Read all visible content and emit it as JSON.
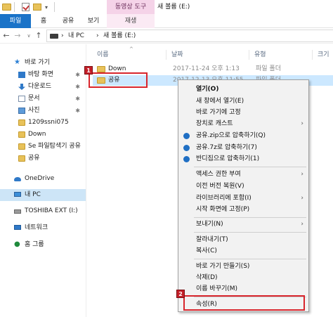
{
  "titlebar": {
    "context_tab": "동영상 도구",
    "window_title": "새 볼륨 (E:)"
  },
  "ribbon": {
    "tabs": [
      "파일",
      "홈",
      "공유",
      "보기",
      "재생"
    ]
  },
  "address": {
    "segments": [
      "›",
      "내 PC",
      "›",
      "새 볼륨 (E:)"
    ]
  },
  "sidebar": {
    "items": [
      {
        "label": "바로 가기",
        "pinned": false
      },
      {
        "label": "바탕 화면",
        "pinned": true
      },
      {
        "label": "다운로드",
        "pinned": true
      },
      {
        "label": "문서",
        "pinned": true
      },
      {
        "label": "사진",
        "pinned": true
      },
      {
        "label": "1209ssni075",
        "pinned": false
      },
      {
        "label": "Down",
        "pinned": false
      },
      {
        "label": "Se 파일탐색기 공유",
        "pinned": false
      },
      {
        "label": "공유",
        "pinned": false
      },
      {
        "label": "OneDrive",
        "pinned": false
      },
      {
        "label": "내 PC",
        "pinned": false
      },
      {
        "label": "TOSHIBA EXT (I:)",
        "pinned": false
      },
      {
        "label": "네트워크",
        "pinned": false
      },
      {
        "label": "홈 그룹",
        "pinned": false
      }
    ],
    "pin_glyph": "✱"
  },
  "columns": {
    "name": "이름",
    "date": "날짜",
    "type": "유형",
    "size": "크기"
  },
  "files": [
    {
      "name": "Down",
      "date": "2017-11-24 오후 1:13",
      "type": "파일 폴더"
    },
    {
      "name": "공유",
      "date": "2017-12-13 오후 11:55",
      "type": "파일 폴더"
    }
  ],
  "callouts": {
    "first": "1",
    "second": "2"
  },
  "context_menu": {
    "open": "열기(O)",
    "open_new_window": "새 창에서 열기(E)",
    "pin_quick_access": "바로 가기에 고정",
    "cast_to_device": "장치로 캐스트",
    "compress_zip": "공유.zip으로 압축하기(Q)",
    "compress_7z": "공유.7z로 압축하기(7)",
    "compress_bandizip": "반디집으로 압축하기(1)",
    "give_access": "액세스 권한 부여",
    "restore_previous": "이전 버전 복원(V)",
    "include_library": "라이브러리에 포함(I)",
    "pin_start": "시작 화면에 고정(P)",
    "send_to": "보내기(N)",
    "cut": "잘라내기(T)",
    "copy": "복사(C)",
    "create_shortcut": "바로 가기 만들기(S)",
    "delete": "삭제(D)",
    "rename": "이름 바꾸기(M)",
    "properties": "속성(R)",
    "submenu_glyph": "›"
  },
  "colors": {
    "accent": "#1a73c8",
    "selection": "#cce8ff",
    "callout": "#d8252c"
  }
}
